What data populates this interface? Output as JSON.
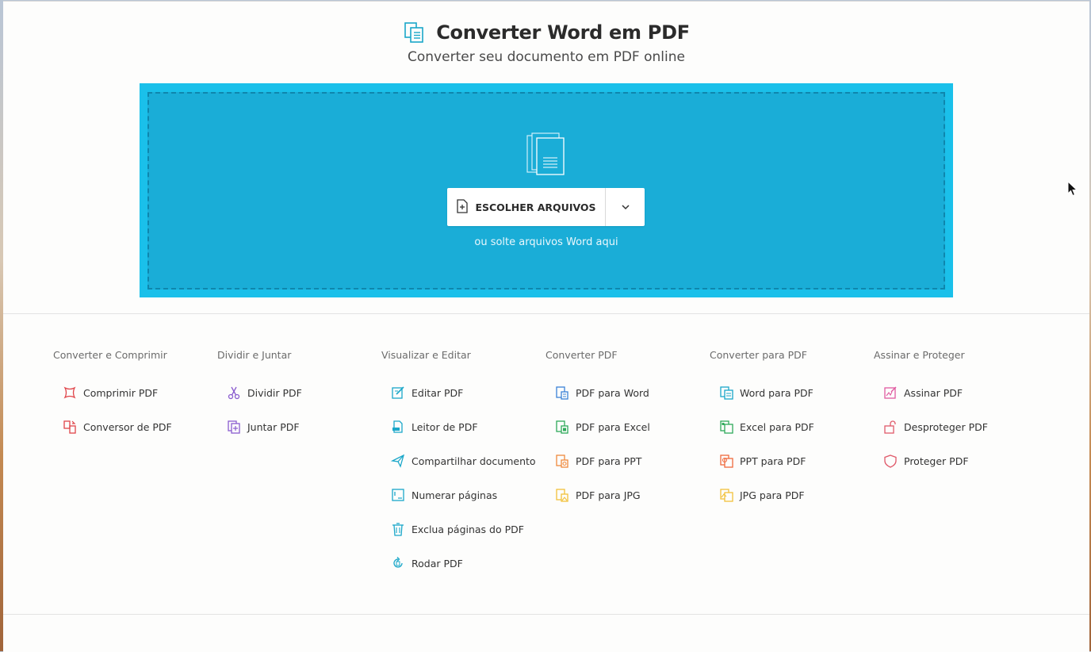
{
  "header": {
    "title": "Converter Word em PDF",
    "subtitle": "Converter seu documento em PDF online"
  },
  "upload": {
    "choose_label": "ESCOLHER ARQUIVOS",
    "drop_hint": "ou solte arquivos Word aqui"
  },
  "menu": {
    "columns": [
      {
        "heading": "Converter e Comprimir",
        "items": [
          {
            "label": "Comprimir PDF",
            "icon": "compress-icon",
            "color": "#e0454a"
          },
          {
            "label": "Conversor de PDF",
            "icon": "convert-icon",
            "color": "#e0454a"
          }
        ]
      },
      {
        "heading": "Dividir e Juntar",
        "items": [
          {
            "label": "Dividir PDF",
            "icon": "scissors-icon",
            "color": "#8a5ccf"
          },
          {
            "label": "Juntar PDF",
            "icon": "merge-icon",
            "color": "#8a5ccf"
          }
        ]
      },
      {
        "heading": "Visualizar e Editar",
        "items": [
          {
            "label": "Editar PDF",
            "icon": "edit-icon",
            "color": "#1aa7c9"
          },
          {
            "label": "Leitor de PDF",
            "icon": "reader-icon",
            "color": "#1aa7c9"
          },
          {
            "label": "Compartilhar documento",
            "icon": "share-icon",
            "color": "#1aa7c9"
          },
          {
            "label": "Numerar páginas",
            "icon": "numbering-icon",
            "color": "#1aa7c9"
          },
          {
            "label": "Exclua páginas do PDF",
            "icon": "trash-icon",
            "color": "#1aa7c9"
          },
          {
            "label": "Rodar PDF",
            "icon": "rotate-icon",
            "color": "#1aa7c9"
          }
        ]
      },
      {
        "heading": "Converter PDF",
        "items": [
          {
            "label": "PDF para Word",
            "icon": "pdf-to-word-icon",
            "color": "#3b82d6"
          },
          {
            "label": "PDF para Excel",
            "icon": "pdf-to-excel-icon",
            "color": "#2faa5a"
          },
          {
            "label": "PDF para PPT",
            "icon": "pdf-to-ppt-icon",
            "color": "#f08a3c"
          },
          {
            "label": "PDF para JPG",
            "icon": "pdf-to-jpg-icon",
            "color": "#f2c23a"
          }
        ]
      },
      {
        "heading": "Converter para PDF",
        "items": [
          {
            "label": "Word para PDF",
            "icon": "word-to-pdf-icon",
            "color": "#1aa7c9"
          },
          {
            "label": "Excel para PDF",
            "icon": "excel-to-pdf-icon",
            "color": "#2faa5a"
          },
          {
            "label": "PPT para PDF",
            "icon": "ppt-to-pdf-icon",
            "color": "#f06a3c"
          },
          {
            "label": "JPG para PDF",
            "icon": "jpg-to-pdf-icon",
            "color": "#f2c23a"
          }
        ]
      },
      {
        "heading": "Assinar e Proteger",
        "items": [
          {
            "label": "Assinar PDF",
            "icon": "sign-icon",
            "color": "#e05aa0"
          },
          {
            "label": "Desproteger PDF",
            "icon": "unlock-icon",
            "color": "#e05a6a"
          },
          {
            "label": "Proteger PDF",
            "icon": "shield-icon",
            "color": "#e05a6a"
          }
        ]
      }
    ]
  },
  "colors": {
    "dropzone_outer": "#1ac0ea",
    "dropzone_inner": "#1aadd7",
    "brand_accent": "#1aa7c9"
  }
}
